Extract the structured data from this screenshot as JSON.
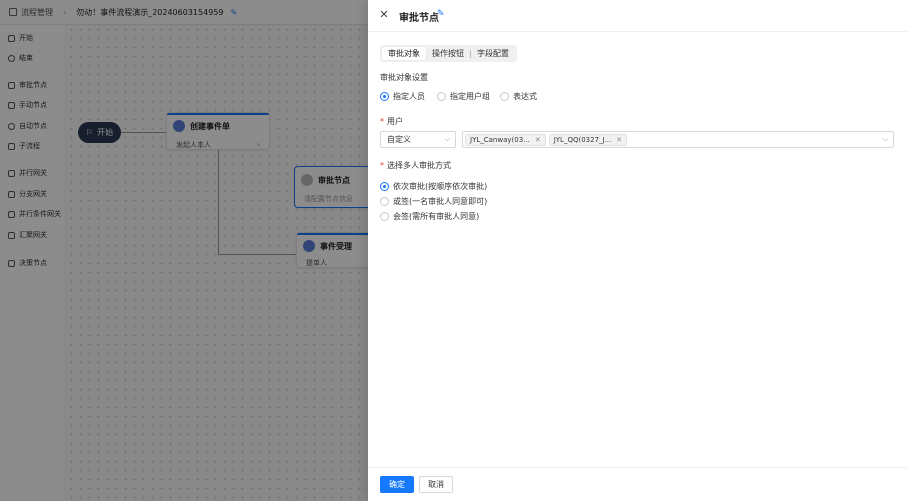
{
  "topbar": {
    "section": "流程管理",
    "flow_title": "勿动！事件流程演示_20240603154959"
  },
  "sidebar": {
    "items": [
      {
        "label": "开始"
      },
      {
        "label": "结束"
      },
      {
        "label": "审批节点"
      },
      {
        "label": "手动节点"
      },
      {
        "label": "自动节点"
      },
      {
        "label": "子流程"
      },
      {
        "label": "并行网关"
      },
      {
        "label": "分支网关"
      },
      {
        "label": "并行条件网关"
      },
      {
        "label": "汇聚网关"
      },
      {
        "label": "决策节点"
      }
    ]
  },
  "canvas": {
    "start_label": "开始",
    "nodes": [
      {
        "title": "创建事件单",
        "sub": "发起人本人"
      },
      {
        "title": "审批节点",
        "sub": "请配置节点信息"
      },
      {
        "title": "事件受理",
        "sub": "提单人"
      }
    ]
  },
  "drawer": {
    "title": "审批节点",
    "tabs": [
      {
        "label": "审批对象",
        "active": true
      },
      {
        "label": "操作按钮",
        "active": false
      },
      {
        "label": "字段配置",
        "active": false
      }
    ],
    "approver_settings": {
      "label": "审批对象设置",
      "options": [
        {
          "label": "指定人员",
          "checked": true
        },
        {
          "label": "指定用户组",
          "checked": false
        },
        {
          "label": "表达式",
          "checked": false
        }
      ]
    },
    "user": {
      "label": "用户",
      "type_select": "自定义",
      "tags": [
        "JYL_Canway(03...",
        "JYL_QQ(0327_J..."
      ]
    },
    "multi_approval": {
      "label": "选择多人审批方式",
      "options": [
        {
          "label": "依次审批(按顺序依次审批)",
          "checked": true
        },
        {
          "label": "或签(一名审批人同意即可)",
          "checked": false
        },
        {
          "label": "会签(需所有审批人同意)",
          "checked": false
        }
      ]
    },
    "footer": {
      "confirm": "确定",
      "cancel": "取消"
    }
  },
  "colors": {
    "primary": "#1677ff",
    "overlay": "rgba(0,0,0,0.45)",
    "start_node": "#2b3a55",
    "required": "#e53935"
  }
}
